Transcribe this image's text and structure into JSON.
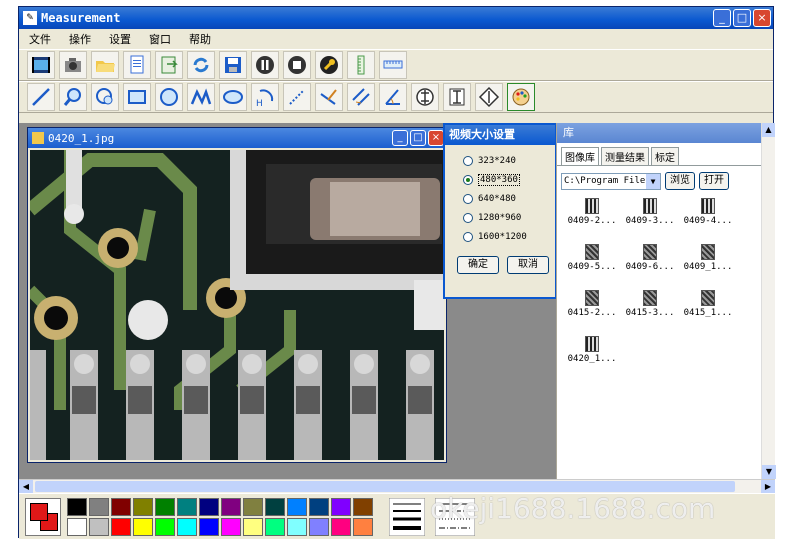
{
  "window": {
    "title": "Measurement",
    "minimize": "_",
    "maximize": "□",
    "close": "×"
  },
  "menu": [
    "文件",
    "操作",
    "设置",
    "窗口",
    "帮助"
  ],
  "toolbar1": [
    "video-icon",
    "camera-icon",
    "open-folder-icon",
    "document-icon",
    "export-icon",
    "refresh-icon",
    "save-icon",
    "pause-icon",
    "stop-icon",
    "wrench-icon",
    "vertical-ruler-icon",
    "horizontal-ruler-icon"
  ],
  "toolbar2": [
    "line-icon",
    "zoom-icon",
    "circle-zoom-icon",
    "rectangle-icon",
    "circle-icon",
    "polyline-icon",
    "ellipse-icon",
    "arc-height-icon",
    "dotted-line-icon",
    "angle-line-icon",
    "parallel-line-icon",
    "angle-icon",
    "horizontal-measure-icon",
    "vertical-measure-icon",
    "diamond-measure-icon",
    "palette-icon"
  ],
  "image_window": {
    "title": "0420_1.jpg"
  },
  "dialog": {
    "title": "视频大小设置",
    "options": [
      "323*240",
      "480*360",
      "640*480",
      "1280*960",
      "1600*1200"
    ],
    "selected_index": 1,
    "ok": "确定",
    "cancel": "取消"
  },
  "library": {
    "title": "库",
    "tabs": [
      "图像库",
      "测量结果",
      "标定"
    ],
    "active_tab": 0,
    "path": "C:\\Program Files",
    "browse": "浏览",
    "open": "打开",
    "thumbnails": [
      "0409-2...",
      "0409-3...",
      "0409-4...",
      "0409-5...",
      "0409-6...",
      "0409_1...",
      "0415-2...",
      "0415-3...",
      "0415_1...",
      "0420_1..."
    ]
  },
  "colors": {
    "current": "#e01818",
    "row1": [
      "#000000",
      "#808080",
      "#800000",
      "#808000",
      "#008000",
      "#008080",
      "#000080",
      "#800080",
      "#808040",
      "#004040",
      "#0080ff",
      "#004080",
      "#8000ff",
      "#804000"
    ],
    "row2": [
      "#ffffff",
      "#c0c0c0",
      "#ff0000",
      "#ffff00",
      "#00ff00",
      "#00ffff",
      "#0000ff",
      "#ff00ff",
      "#ffff80",
      "#00ff80",
      "#80ffff",
      "#8080ff",
      "#ff0080",
      "#ff8040"
    ]
  },
  "watermark": "okeji1688.1688.com"
}
